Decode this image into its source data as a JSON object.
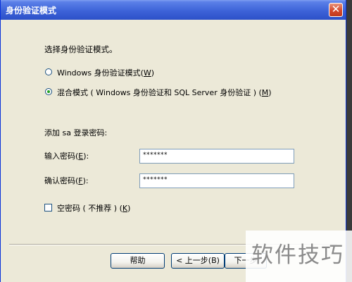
{
  "window": {
    "title": "身份验证模式",
    "close_glyph": "✕"
  },
  "prompt": "选择身份验证模式。",
  "auth_options": [
    {
      "label": "Windows 身份验证模式(",
      "key": "W",
      "suffix": ")",
      "checked": false
    },
    {
      "label": "混合模式 ( Windows 身份验证和 SQL Server 身份验证 ) (",
      "key": "M",
      "suffix": ")",
      "checked": true
    }
  ],
  "sa_heading": "添加 sa 登录密码:",
  "password": {
    "label": "输入密码(",
    "key": "E",
    "suffix": "):",
    "value": "*******"
  },
  "confirm": {
    "label": "确认密码(",
    "key": "F",
    "suffix": "):",
    "value": "*******"
  },
  "blank_password": {
    "label": "空密码 ( 不推荐 ) (",
    "key": "K",
    "suffix": ")",
    "checked": false
  },
  "buttons": {
    "help": "帮助",
    "back": "< 上一步(B)",
    "next": "下一步"
  },
  "watermark": "软件技巧",
  "colors": {
    "titlebar": "#2c50c8",
    "dialog_bg": "#ece9d8",
    "close": "#d5482c"
  }
}
